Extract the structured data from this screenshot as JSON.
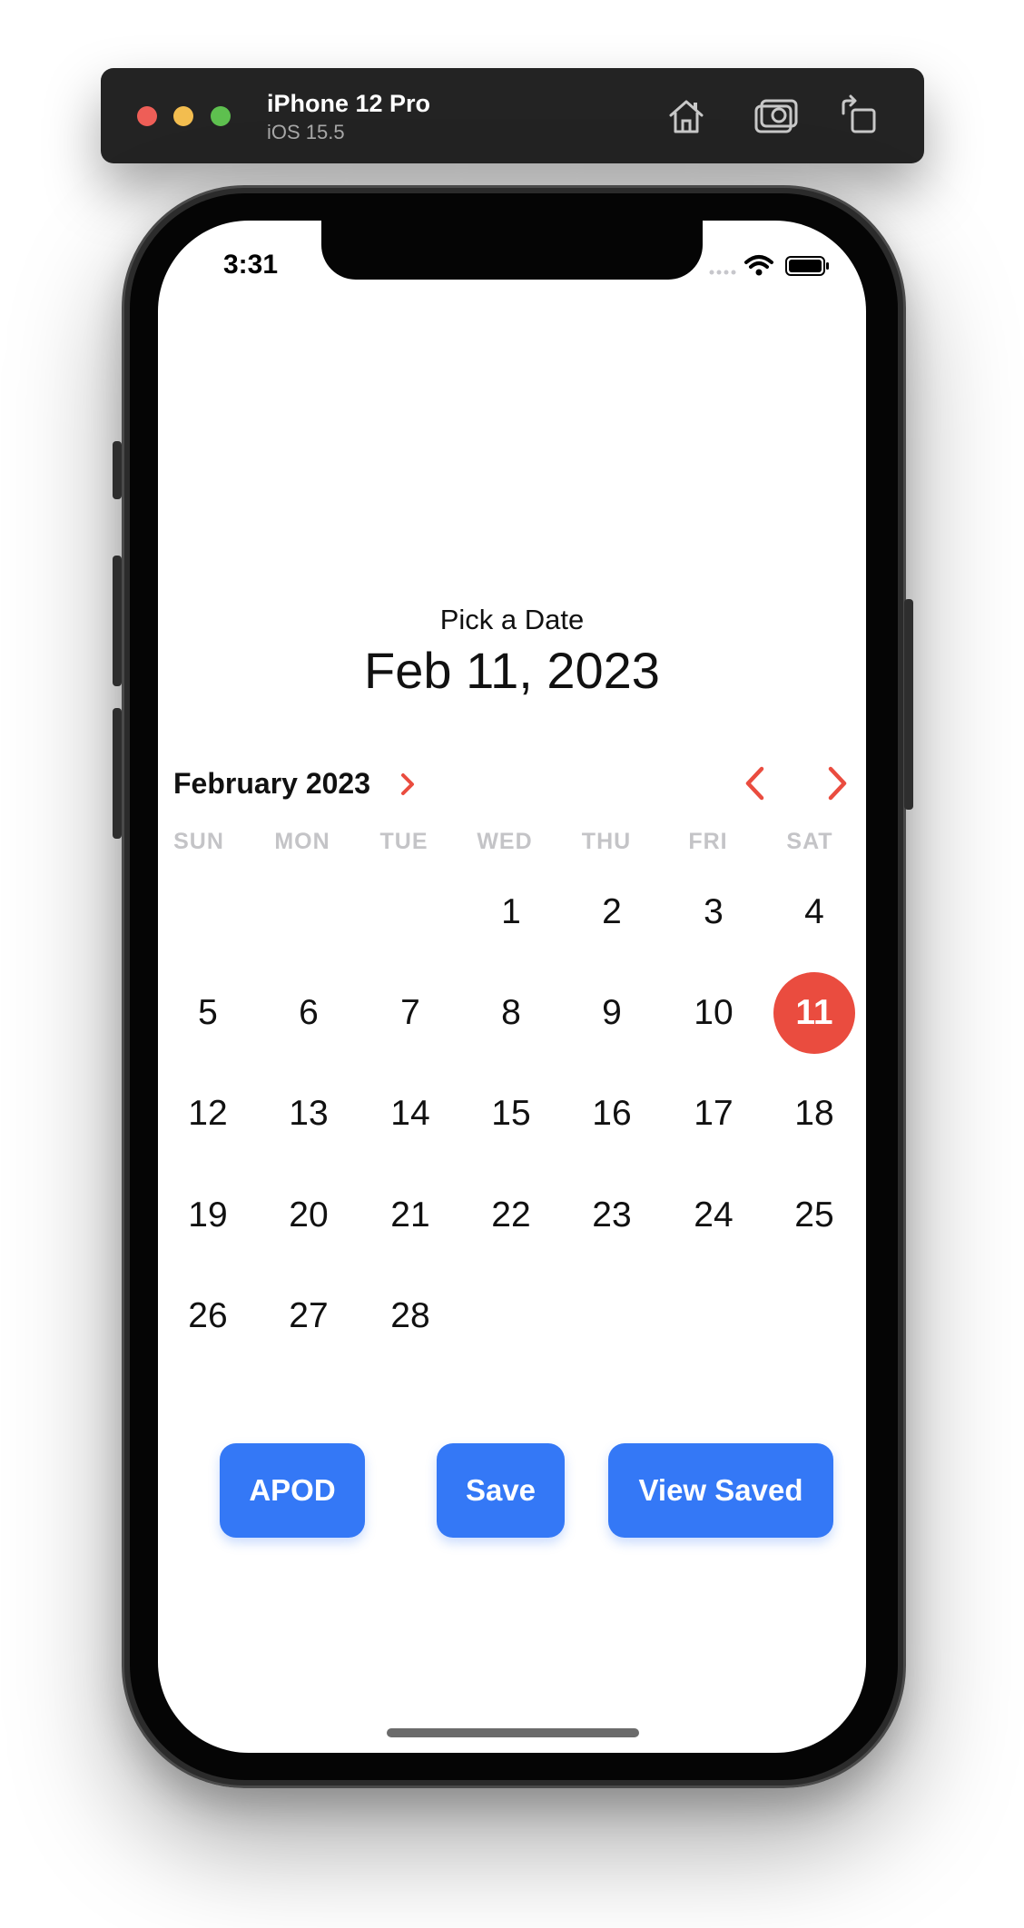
{
  "simulator": {
    "device_name": "iPhone 12 Pro",
    "os_version": "iOS 15.5",
    "toolbar_icons": [
      "home-icon",
      "screenshot-icon",
      "rotate-icon"
    ]
  },
  "status_bar": {
    "time": "3:31",
    "icons": [
      "cellular-icon",
      "wifi-icon",
      "battery-icon"
    ]
  },
  "picker": {
    "label": "Pick a Date",
    "selected_date": "Feb 11, 2023"
  },
  "calendar": {
    "month_label": "February 2023",
    "weekdays": [
      "SUN",
      "MON",
      "TUE",
      "WED",
      "THU",
      "FRI",
      "SAT"
    ],
    "weeks": [
      [
        "",
        "",
        "",
        "1",
        "2",
        "3",
        "4"
      ],
      [
        "5",
        "6",
        "7",
        "8",
        "9",
        "10",
        "11"
      ],
      [
        "12",
        "13",
        "14",
        "15",
        "16",
        "17",
        "18"
      ],
      [
        "19",
        "20",
        "21",
        "22",
        "23",
        "24",
        "25"
      ],
      [
        "26",
        "27",
        "28",
        "",
        "",
        "",
        ""
      ]
    ],
    "selected_day": "11"
  },
  "buttons": {
    "apod": "APOD",
    "save": "Save",
    "view_saved": "View Saved"
  },
  "colors": {
    "accent_red": "#ea4c3f",
    "button_blue": "#3478f6"
  }
}
